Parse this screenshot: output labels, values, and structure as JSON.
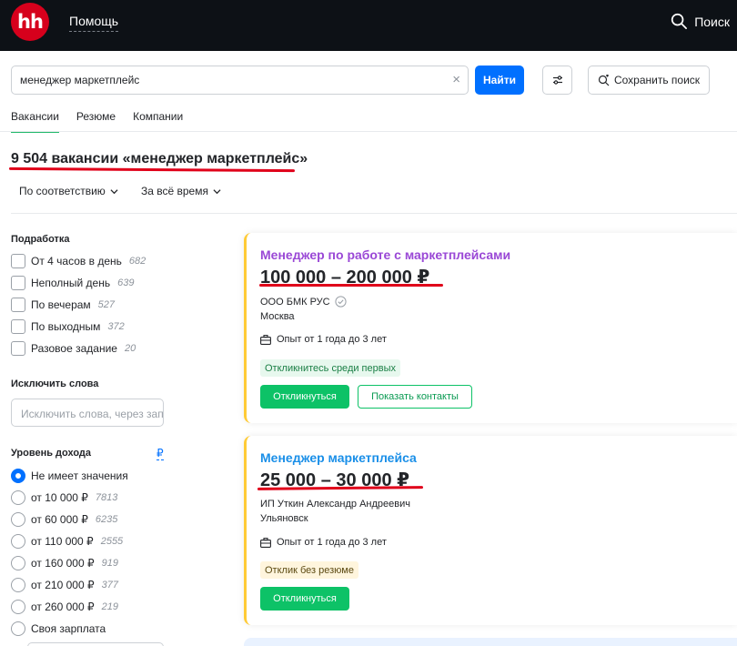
{
  "header": {
    "logo_text": "hh",
    "help_label": "Помощь",
    "search_label": "Поиск",
    "logo_color": "#d6001c",
    "bg_color": "#0d1116"
  },
  "search": {
    "query": "менеджер маркетплейс",
    "clear_icon": "×",
    "find_label": "Найти",
    "filter_icon": "sliders-icon",
    "save_search_label": "Сохранить поиск"
  },
  "tabs": [
    {
      "label": "Вакансии",
      "active": true
    },
    {
      "label": "Резюме",
      "active": false
    },
    {
      "label": "Компании",
      "active": false
    }
  ],
  "results": {
    "count_text": "9 504 вакансии «менеджер маркетплейс»",
    "sort_relevance": "По соответствию",
    "sort_period": "За всё время"
  },
  "sidebar": {
    "side_job": {
      "title": "Подработка",
      "items": [
        {
          "label": "От 4 часов в день",
          "count": "682"
        },
        {
          "label": "Неполный день",
          "count": "639"
        },
        {
          "label": "По вечерам",
          "count": "527"
        },
        {
          "label": "По выходным",
          "count": "372"
        },
        {
          "label": "Разовое задание",
          "count": "20"
        }
      ]
    },
    "exclude": {
      "title": "Исключить слова",
      "placeholder": "Исключить слова, через запятую"
    },
    "income": {
      "title": "Уровень дохода",
      "currency": "₽",
      "items": [
        {
          "label": "Не имеет значения",
          "count": "",
          "selected": true
        },
        {
          "label": "от 10 000 ₽",
          "count": "7813",
          "selected": false
        },
        {
          "label": "от 60 000 ₽",
          "count": "6235",
          "selected": false
        },
        {
          "label": "от 110 000 ₽",
          "count": "2555",
          "selected": false
        },
        {
          "label": "от 160 000 ₽",
          "count": "919",
          "selected": false
        },
        {
          "label": "от 210 000 ₽",
          "count": "377",
          "selected": false
        },
        {
          "label": "от 260 000 ₽",
          "count": "219",
          "selected": false
        },
        {
          "label": "Своя зарплата",
          "count": "",
          "selected": false
        }
      ]
    }
  },
  "vacancies": [
    {
      "title": "Менеджер по работе с маркетплейсами",
      "title_color": "#9a48d6",
      "salary": "100 000 – 200 000 ₽",
      "company": "ООО БМК РУС",
      "verified": true,
      "city": "Москва",
      "experience": "Опыт от 1 года до 3 лет",
      "badge": "Откликнитесь среди первых",
      "badge_bg": "#e7f8ee",
      "badge_color": "#1a7f45",
      "respond_label": "Откликнуться",
      "contacts_label": "Показать контакты"
    },
    {
      "title": "Менеджер маркетплейса",
      "title_color": "#1a8fe8",
      "salary": "25 000 – 30 000 ₽",
      "company": "ИП Уткин Александр Андреевич",
      "verified": false,
      "city": "Ульяновск",
      "experience": "Опыт от 1 года до 3 лет",
      "badge": "Отклик без резюме",
      "badge_bg": "#fff5dd",
      "badge_color": "#5c4a12",
      "respond_label": "Откликнуться",
      "contacts_label": ""
    }
  ],
  "accent_color": "#0070ff",
  "annotation_color": "#e0001a"
}
